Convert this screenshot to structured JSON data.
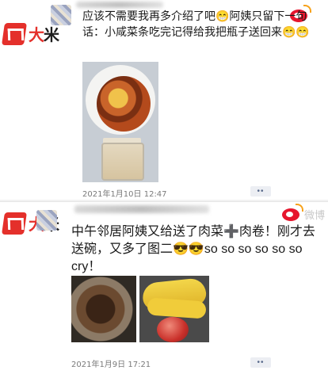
{
  "post1": {
    "logo": {
      "text": "大米",
      "accent": "#e4302b"
    },
    "weibo_icon": "weibo-icon",
    "text": "应该不需要我再多介绍了吧😁阿姨只留下一句话：小咸菜条吃完记得给我把瓶子送回来😁😁",
    "photo_icon": "food-bowl-and-jar-photo",
    "date": "2021年1月10日 12:47",
    "more_label": "••"
  },
  "post2": {
    "logo": {
      "text": "大米",
      "accent": "#e4302b"
    },
    "weibo_label": "微博",
    "text": "中午邻居阿姨又给送了肉菜➕肉卷！刚才去送碗，又多了图二😎😎so so so so so so cry！",
    "photos": [
      "meat-dish-photo",
      "banana-apple-photo"
    ],
    "date": "2021年1月9日 17:21",
    "more_label": "••"
  }
}
